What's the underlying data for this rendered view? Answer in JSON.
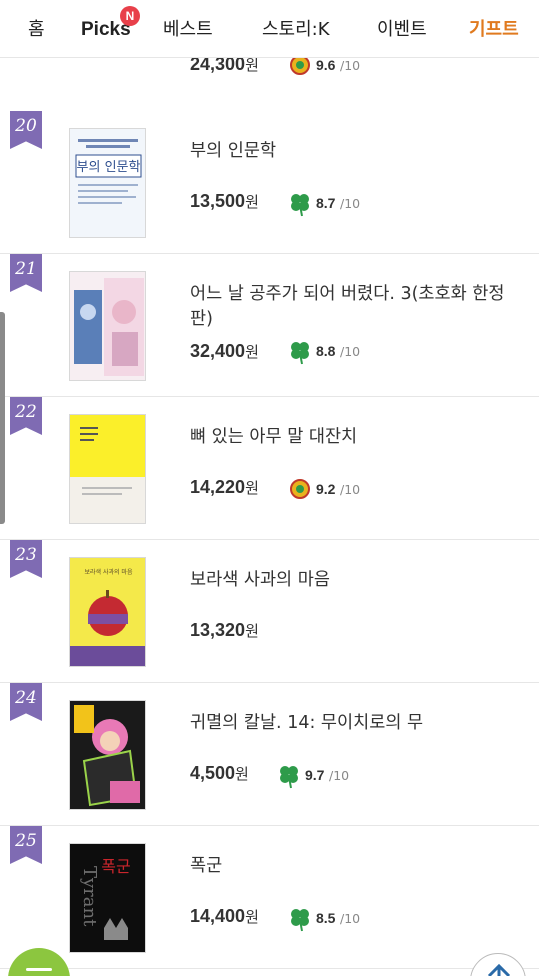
{
  "nav": {
    "tabs": [
      "홈",
      "Picks",
      "베스트",
      "스토리:K",
      "이벤트",
      "기프트"
    ],
    "picks_badge": "N",
    "active_tab": "기프트",
    "active_color": "#e07a1f"
  },
  "list": {
    "price_unit": "원",
    "score_suffix": "/10",
    "partial_top": {
      "price": "24,300",
      "score": "9.6"
    },
    "items": [
      {
        "rank": "20",
        "title": "부의 인문학",
        "price": "13,500",
        "rating_icon": "clover-icon",
        "score": "8.7"
      },
      {
        "rank": "21",
        "title": "어느 날 공주가 되어 버렸다. 3(초호화 한정판)",
        "price": "32,400",
        "rating_icon": "clover-icon",
        "score": "8.8"
      },
      {
        "rank": "22",
        "title": "뼈 있는 아무 말 대잔치",
        "price": "14,220",
        "rating_icon": "medal-icon",
        "score": "9.2"
      },
      {
        "rank": "23",
        "title": "보라색 사과의 마음",
        "price": "13,320",
        "rating_icon": "",
        "score": ""
      },
      {
        "rank": "24",
        "title": "귀멸의 칼날. 14: 무이치로의 무",
        "price": "4,500",
        "rating_icon": "clover-icon",
        "score": "9.7"
      },
      {
        "rank": "25",
        "title": "폭군",
        "price": "14,400",
        "rating_icon": "clover-icon",
        "score": "8.5"
      }
    ]
  },
  "covers": {
    "0": {
      "lines": [
        "부의 인문학"
      ]
    },
    "3": {
      "lines": [
        "보라색 사과의 마음"
      ]
    },
    "5": {
      "lines": [
        "폭군",
        "Tyrant"
      ]
    }
  },
  "colors": {
    "rank_ribbon": "#7f6bb3",
    "menu_button": "#8cc63f",
    "clover": "#2e9b4a"
  },
  "icons": {
    "menu_button": "menu-icon",
    "top_button": "arrow-up-icon"
  }
}
